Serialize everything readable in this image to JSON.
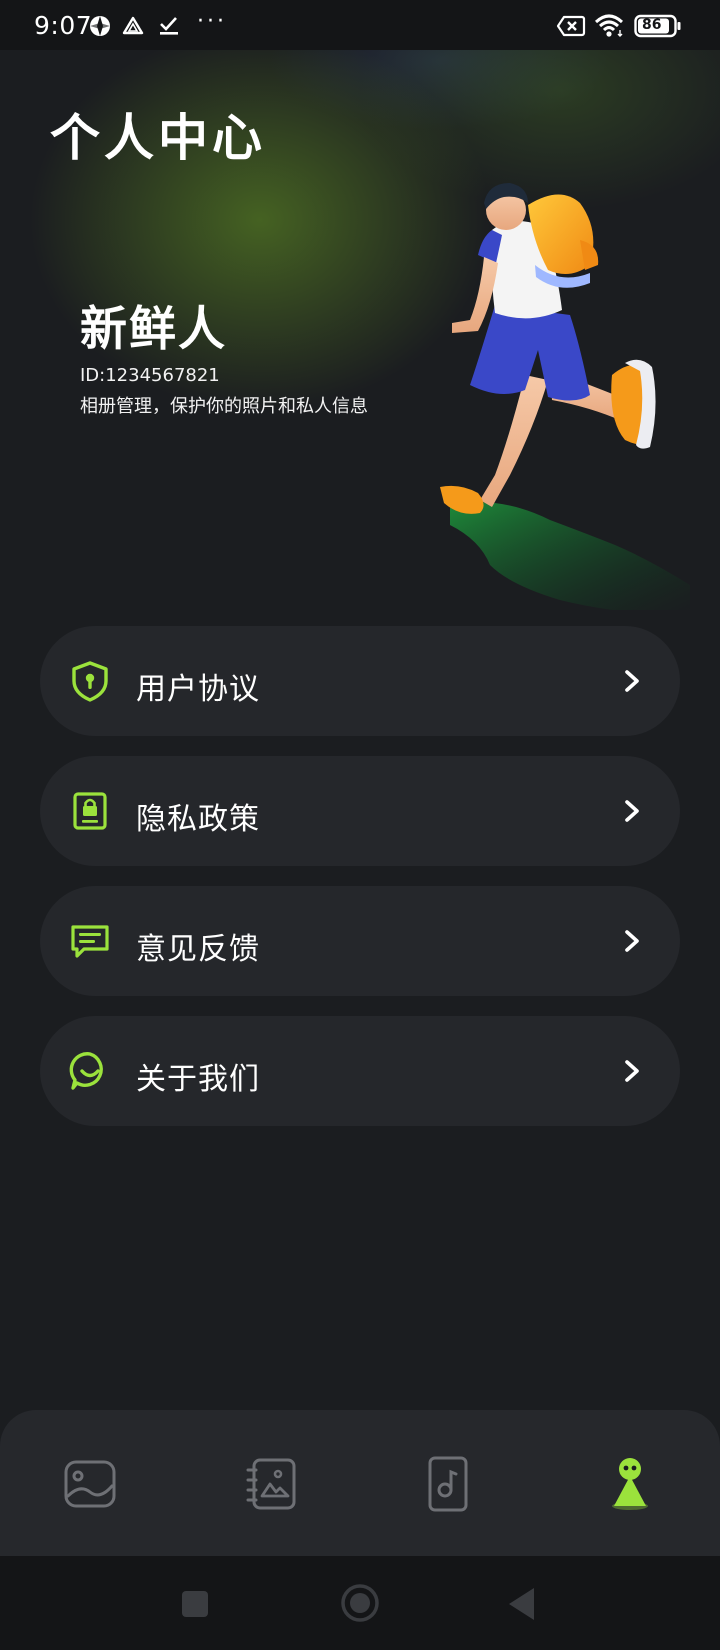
{
  "status_bar": {
    "time": "9:07",
    "battery": "86"
  },
  "hero": {
    "page_title": "个人中心",
    "user_name": "新鲜人",
    "user_id": "ID:1234567821",
    "description": "相册管理，保护你的照片和私人信息"
  },
  "menu": {
    "items": [
      {
        "label": "用户协议",
        "icon": "shield-icon"
      },
      {
        "label": "隐私政策",
        "icon": "privacy-lock-icon"
      },
      {
        "label": "意见反馈",
        "icon": "message-icon"
      },
      {
        "label": "关于我们",
        "icon": "chat-smile-icon"
      }
    ]
  },
  "bottom_nav": {
    "items": [
      "gallery-icon",
      "album-icon",
      "music-icon",
      "profile-icon"
    ],
    "active_index": 3
  },
  "colors": {
    "accent": "#9be23c",
    "background": "#1b1d20",
    "card": "#25272b"
  }
}
